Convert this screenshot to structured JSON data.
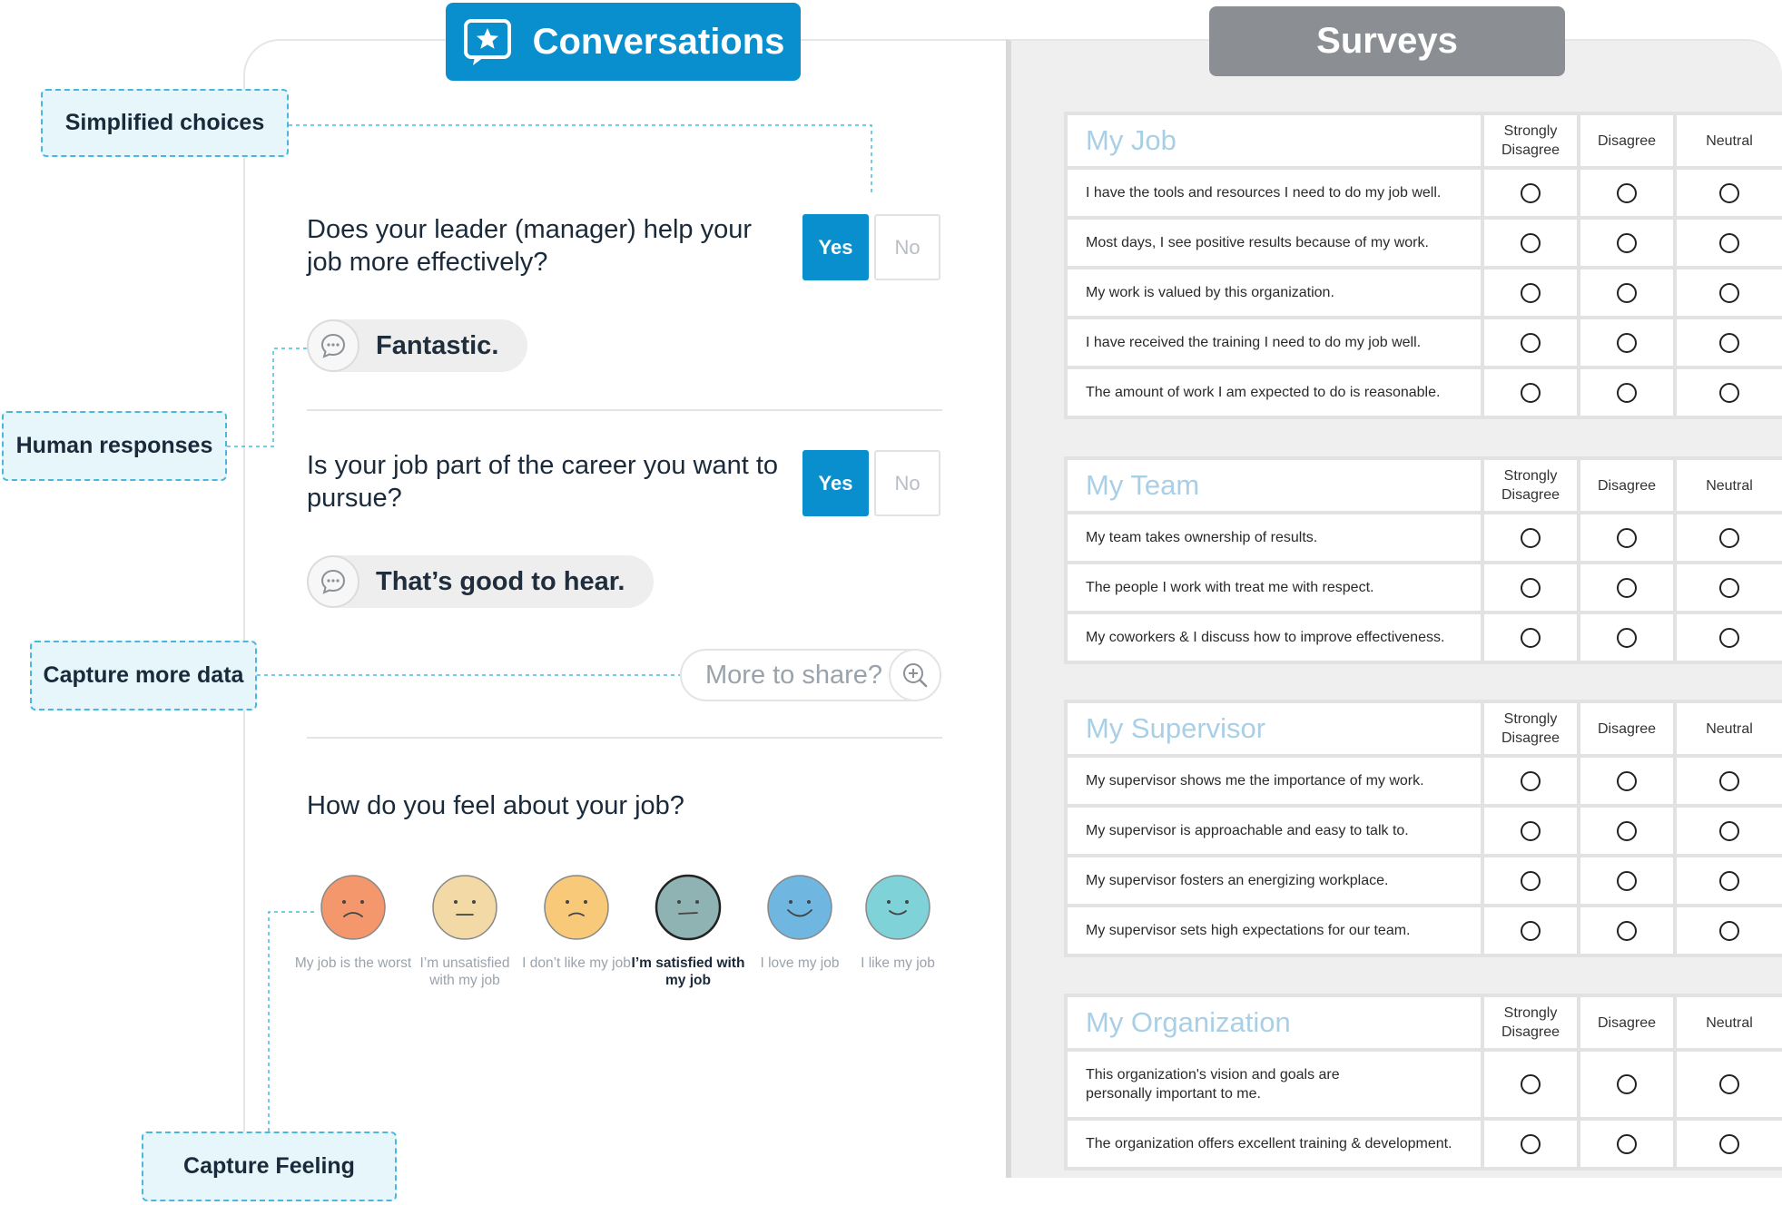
{
  "tabs": {
    "conversations": "Conversations",
    "surveys": "Surveys"
  },
  "callouts": {
    "simplified_choices": "Simplified choices",
    "human_responses": "Human responses",
    "capture_more_data": "Capture more data",
    "capture_feeling": "Capture Feeling"
  },
  "conversation": {
    "q1": "Does your leader (manager) help your job more effectively?",
    "q1_yes": "Yes",
    "q1_no": "No",
    "reply1": "Fantastic.",
    "q2": "Is your job part of the career you want to pursue?",
    "q2_yes": "Yes",
    "q2_no": "No",
    "reply2": "That’s good to hear.",
    "more_to_share": "More to share?",
    "q3": "How do you feel about your job?",
    "faces": [
      {
        "label": "My job is the worst",
        "color": "#f4976c",
        "selected": false
      },
      {
        "label": "I’m unsatisfied with my job",
        "color": "#f2d9a6",
        "selected": false
      },
      {
        "label": "I don’t like my job",
        "color": "#f9c97a",
        "selected": false
      },
      {
        "label": "I’m satisfied with my job",
        "color": "#8fb3b3",
        "selected": true
      },
      {
        "label": "I love my job",
        "color": "#6fb7e0",
        "selected": false
      },
      {
        "label": "I like my job",
        "color": "#7fd3d8",
        "selected": false
      }
    ]
  },
  "survey": {
    "headers": {
      "strongly_disagree": "Strongly Disagree",
      "disagree": "Disagree",
      "neutral": "Neutral"
    },
    "sections": [
      {
        "title": "My Job",
        "items": [
          "I have the tools and resources I need to do my job well.",
          "Most days, I see positive results because of my work.",
          "My work is valued by this organization.",
          "I have received the training I need to do my job well.",
          "The amount of work I am expected to do is reasonable."
        ]
      },
      {
        "title": "My Team",
        "items": [
          "My team takes ownership of results.",
          "The people I work with treat me with respect.",
          "My coworkers & I discuss how to improve effectiveness."
        ]
      },
      {
        "title": "My Supervisor",
        "items": [
          "My supervisor shows me the importance of my work.",
          "My supervisor is approachable and easy to talk to.",
          "My supervisor fosters an energizing workplace.",
          "My supervisor sets high expectations for our team."
        ]
      },
      {
        "title": "My Organization",
        "items": [
          "This organization's vision and goals are personally important to me.",
          "The organization offers excellent training & development."
        ]
      }
    ]
  },
  "colors": {
    "accent": "#0a8fce",
    "callout_border": "#4ab8dc",
    "callout_bg": "#e7f6fb",
    "survey_tab": "#8b8f94",
    "section_title": "#a9cfe6"
  },
  "icons": {
    "conversations_tab": "chat-star-icon",
    "reply": "speech-bubble-icon",
    "more": "zoom-plus-icon"
  }
}
